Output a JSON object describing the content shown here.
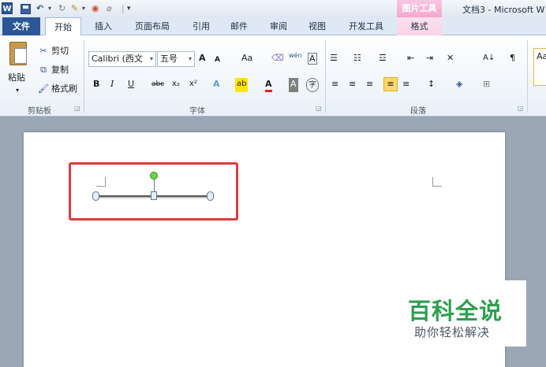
{
  "quick_access": {
    "app_icon": "W",
    "undo_glyph": "↶",
    "dropdown_glyph": "▾",
    "redo_glyph": "↻",
    "brush_glyph": "✎",
    "color_glyph": "◉",
    "clear_glyph": "⌀",
    "separator": "|",
    "customize_glyph": "▾"
  },
  "title_bar": {
    "contextual_group": "图片工具",
    "document_title": "文档3 - Microsoft W"
  },
  "tabs": {
    "file": "文件",
    "home": "开始",
    "insert": "插入",
    "page_layout": "页面布局",
    "references": "引用",
    "mailings": "邮件",
    "review": "审阅",
    "view": "视图",
    "developer": "开发工具",
    "format": "格式"
  },
  "clipboard": {
    "paste": "粘贴",
    "paste_dd": "▾",
    "cut": "剪切",
    "copy": "复制",
    "format_painter": "格式刷",
    "group_label": "剪贴板",
    "cut_icon": "✂",
    "copy_icon": "⧉",
    "painter_icon": "🖌"
  },
  "font": {
    "name": "Calibri (西文",
    "size": "五号",
    "dd": "▾",
    "grow": "A",
    "shrink": "A",
    "change_case": "Aa",
    "clear_format": "⌫",
    "phonetic": "wén",
    "border_char": "A",
    "bold": "B",
    "italic": "I",
    "underline": "U",
    "strike": "abc",
    "subscript": "x₂",
    "superscript": "x²",
    "text_effect": "A",
    "highlight": "ab",
    "font_color": "A",
    "char_shading": "A",
    "enclose": "字",
    "group_label": "字体"
  },
  "paragraph": {
    "bullets": "☰",
    "numbering": "☷",
    "multilevel": "☲",
    "dec_indent": "⇤",
    "inc_indent": "⇥",
    "chinese_layout": "✕",
    "sort": "A↓",
    "show_marks": "¶",
    "align_left": "≡",
    "center": "≡",
    "align_right": "≡",
    "justify": "≡",
    "distributed": "≡",
    "line_spacing": "↕",
    "shading": "◈",
    "borders": "⊞",
    "group_label": "段落"
  },
  "styles": {
    "sample": "Aa"
  },
  "watermark": {
    "title": "百科全说",
    "subtitle": "助你轻松解决"
  }
}
